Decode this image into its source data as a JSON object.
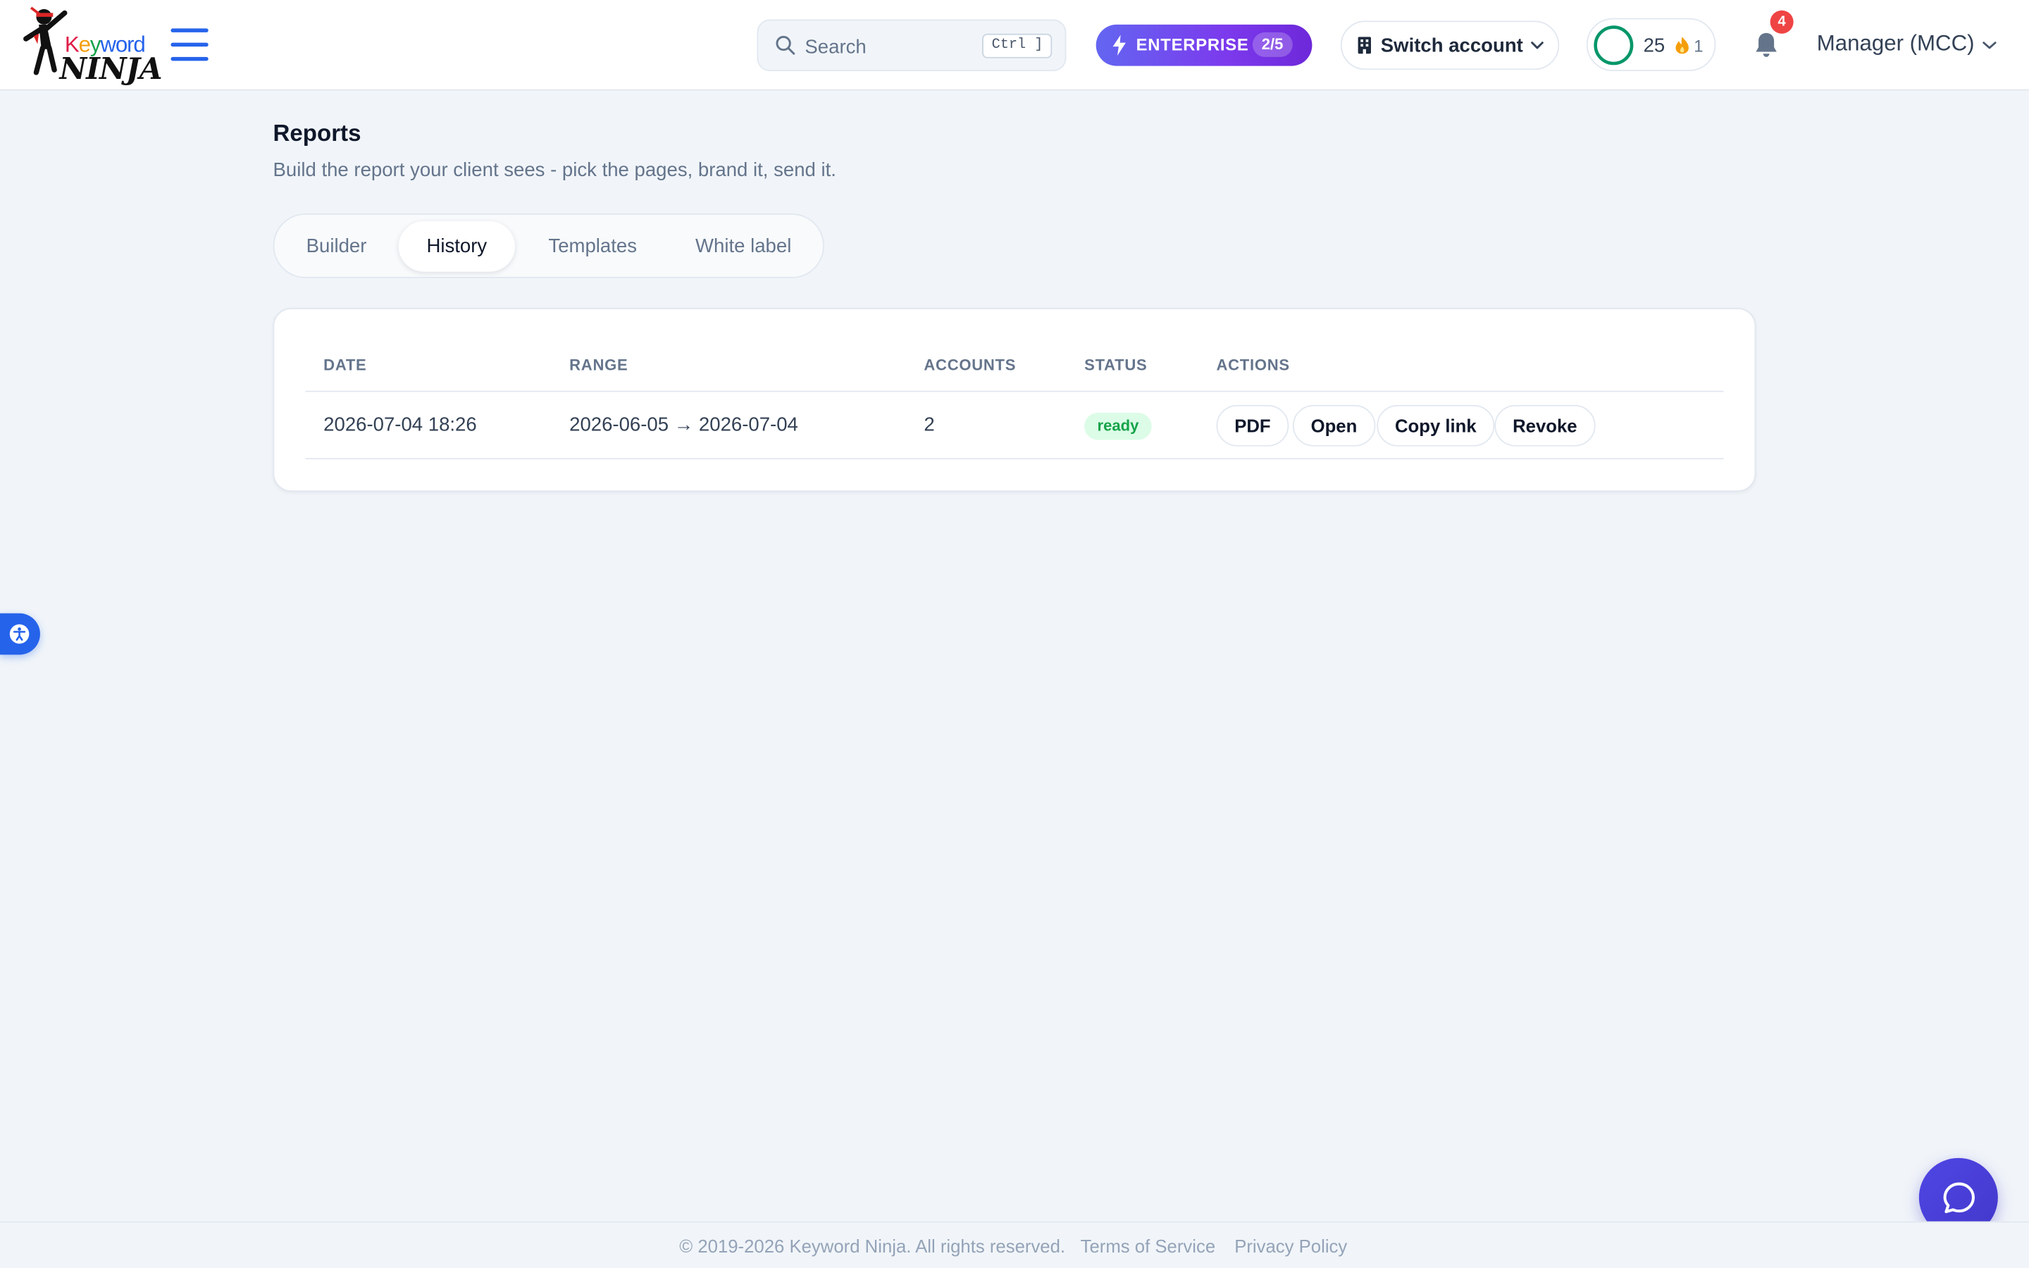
{
  "header": {
    "logo": {
      "line1": "Keyword",
      "line2": "NINJA"
    },
    "search": {
      "placeholder": "Search",
      "shortcut": "Ctrl ]"
    },
    "plan": {
      "label": "ENTERPRISE",
      "count": "2/5"
    },
    "switch_account": {
      "label": "Switch account"
    },
    "streak": {
      "value": "25",
      "fire_value": "1",
      "ring_color": "#059669"
    },
    "notifications": {
      "badge": "4"
    },
    "account": {
      "label": "Manager (MCC)"
    }
  },
  "main": {
    "title": "Reports",
    "subtitle": "Build the report your client sees - pick the pages, brand it, send it.",
    "tabs": [
      {
        "label": "Builder",
        "active": false
      },
      {
        "label": "History",
        "active": true
      },
      {
        "label": "Templates",
        "active": false
      },
      {
        "label": "White label",
        "active": false
      }
    ],
    "table": {
      "columns": [
        "DATE",
        "RANGE",
        "ACCOUNTS",
        "STATUS",
        "ACTIONS"
      ],
      "rows": [
        {
          "date": "2026-07-04 18:26",
          "range": "2026-06-05 → 2026-07-04",
          "accounts": "2",
          "status": "ready",
          "actions": [
            "PDF",
            "Open",
            "Copy link",
            "Revoke"
          ]
        }
      ]
    }
  },
  "footer": {
    "copyright": "© 2019-2026 Keyword Ninja. All rights reserved.",
    "links": [
      "Terms of Service",
      "Privacy Policy"
    ]
  },
  "colors": {
    "accent": "#2563eb",
    "plan_gradient_start": "#6366f1",
    "plan_gradient_end": "#6d28d9",
    "status_ready_bg": "#dcfce7",
    "status_ready_text": "#16a34a",
    "badge": "#ef4444"
  },
  "icons": [
    "search-icon",
    "bolt-icon",
    "building-icon",
    "chevron-down-icon",
    "flame-icon",
    "bell-icon",
    "accessibility-icon",
    "chat-icon",
    "hamburger-icon"
  ]
}
